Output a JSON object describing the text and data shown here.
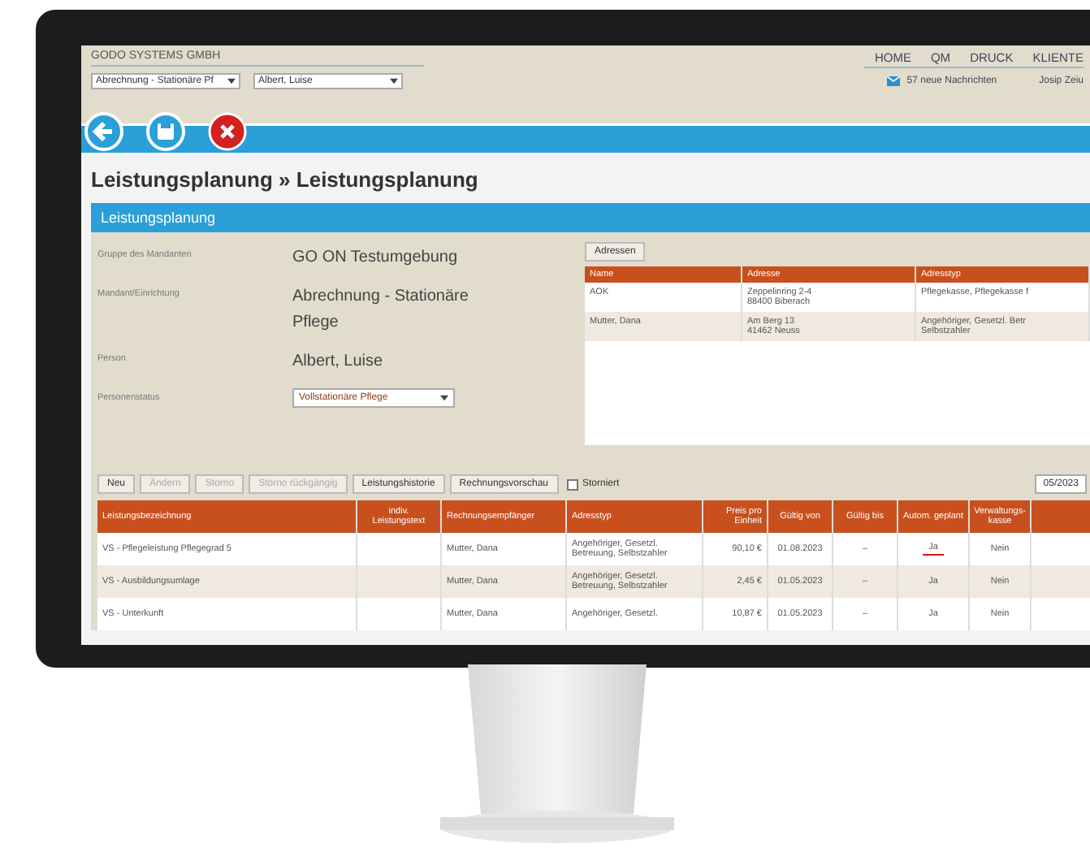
{
  "header": {
    "company": "GODO SYSTEMS GMBH",
    "selects": [
      "Abrechnung - Stationäre Pf",
      "Albert, Luise"
    ],
    "nav": [
      "HOME",
      "QM",
      "DRUCK",
      "KLIENTE"
    ],
    "messages": "57 neue Nachrichten",
    "user": "Josip Zeiu"
  },
  "title": "Leistungsplanung » Leistungsplanung",
  "panel": {
    "title": "Leistungsplanung",
    "fields": [
      {
        "kind": "text",
        "label": "Gruppe des Mandanten",
        "value": "GO ON Testumgebung"
      },
      {
        "kind": "text",
        "label": "Mandant/Einrichtung",
        "value": "Abrechnung - Stationäre Pflege"
      },
      {
        "kind": "text",
        "label": "Person",
        "value": "Albert, Luise"
      },
      {
        "kind": "select",
        "label": "Personenstatus",
        "value": "Vollstationäre Pflege"
      }
    ],
    "address_button": "Adressen",
    "addresses": {
      "columns": [
        "Name",
        "Adresse",
        "Adresstyp"
      ],
      "rows": [
        [
          "AOK",
          "Zeppelinring 2-4\n88400 Biberach",
          "Pflegekasse, Pflegekasse f"
        ],
        [
          "Mutter, Dana",
          "Am Berg 13\n41462 Neuss",
          "Angehöriger, Gesetzl. Betr\nSelbstzahler"
        ]
      ]
    },
    "toolbar": [
      {
        "label": "Neu",
        "disabled": false
      },
      {
        "label": "Ändern",
        "disabled": true
      },
      {
        "label": "Storno",
        "disabled": true
      },
      {
        "label": "Storno rückgängig",
        "disabled": true
      },
      {
        "label": "Leistungshistorie",
        "disabled": false
      },
      {
        "label": "Rechnungsvorschau",
        "disabled": false
      }
    ],
    "storniert": {
      "label": "Storniert",
      "checked": false
    },
    "period": "05/2023",
    "table": {
      "columns": [
        "Leistungsbezeichnung",
        "indiv. Leistungstext",
        "Rechnungsempfänger",
        "Adresstyp",
        "Preis pro Einheit",
        "Gültig von",
        "Gültig bis",
        "Autom. geplant",
        "Verwaltungs-kasse"
      ],
      "rows": [
        {
          "cells": [
            "VS - Pflegeleistung Pflegegrad 5",
            "",
            "Mutter, Dana",
            "Angehöriger, Gesetzl. Betreuung, Selbstzahler",
            "90,10 €",
            "01.08.2023",
            "–",
            "Ja",
            "Nein"
          ],
          "underlined": true
        },
        {
          "cells": [
            "VS - Ausbildungsumlage",
            "",
            "Mutter, Dana",
            "Angehöriger, Gesetzl. Betreuung, Selbstzahler",
            "2,45 €",
            "01.05.2023",
            "–",
            "Ja",
            "Nein"
          ],
          "underlined": false
        },
        {
          "cells": [
            "VS - Unterkunft",
            "",
            "Mutter, Dana",
            "Angehöriger, Gesetzl.",
            "10,87 €",
            "01.05.2023",
            "–",
            "Ja",
            "Nein"
          ],
          "underlined": false
        }
      ]
    }
  }
}
